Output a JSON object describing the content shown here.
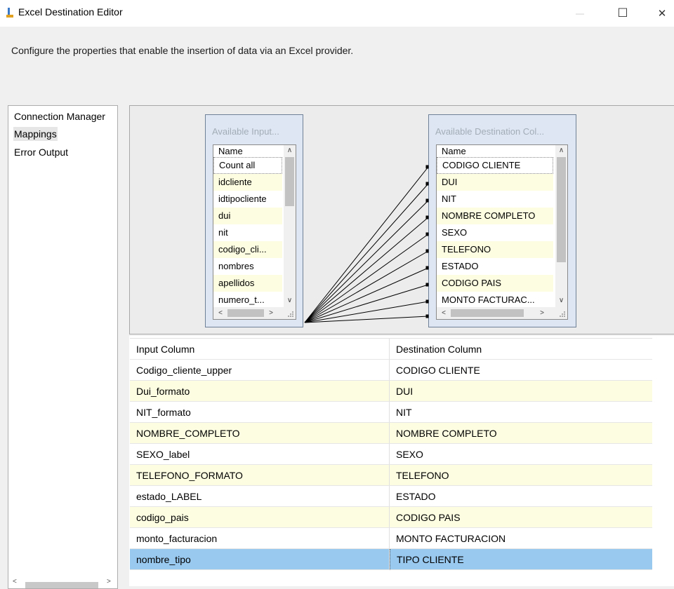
{
  "window": {
    "title": "Excel Destination Editor",
    "controls": {
      "minimize": "—",
      "maximize": "☐",
      "close": "✕"
    }
  },
  "description": "Configure the properties that enable the insertion of data via an Excel provider.",
  "nav": {
    "items": [
      {
        "label": "Connection Manager",
        "selected": false
      },
      {
        "label": "Mappings",
        "selected": true
      },
      {
        "label": "Error Output",
        "selected": false
      }
    ]
  },
  "diagram": {
    "input_table": {
      "title": "Available Input...",
      "header": "Name",
      "items": [
        "Count all",
        "idcliente",
        "idtipocliente",
        "dui",
        "nit",
        "codigo_cli...",
        "nombres",
        "apellidos",
        "numero_t..."
      ]
    },
    "destination_table": {
      "title": "Available Destination Col...",
      "header": "Name",
      "items": [
        "CODIGO CLIENTE",
        "DUI",
        "NIT",
        "NOMBRE COMPLETO",
        "SEXO",
        "TELEFONO",
        "ESTADO",
        "CODIGO PAIS",
        "MONTO FACTURAC..."
      ]
    },
    "scroll_glyphs": {
      "up": "∧",
      "down": "∨",
      "left": "<",
      "right": ">"
    }
  },
  "grid": {
    "headers": {
      "input": "Input Column",
      "destination": "Destination Column"
    },
    "rows": [
      {
        "input": "Codigo_cliente_upper",
        "destination": "CODIGO CLIENTE"
      },
      {
        "input": "Dui_formato",
        "destination": "DUI"
      },
      {
        "input": "NIT_formato",
        "destination": "NIT"
      },
      {
        "input": "NOMBRE_COMPLETO",
        "destination": "NOMBRE COMPLETO"
      },
      {
        "input": "SEXO_label",
        "destination": "SEXO"
      },
      {
        "input": "TELEFONO_FORMATO",
        "destination": "TELEFONO"
      },
      {
        "input": "estado_LABEL",
        "destination": "ESTADO"
      },
      {
        "input": "codigo_pais",
        "destination": "CODIGO PAIS"
      },
      {
        "input": "monto_facturacion",
        "destination": "MONTO FACTURACION"
      },
      {
        "input": "nombre_tipo",
        "destination": "TIPO CLIENTE"
      }
    ],
    "selected_row": 9
  },
  "colors": {
    "alt_row": "#fdfde2",
    "selected_row": "#99c9ef",
    "table_frame": "#dde6f2"
  }
}
